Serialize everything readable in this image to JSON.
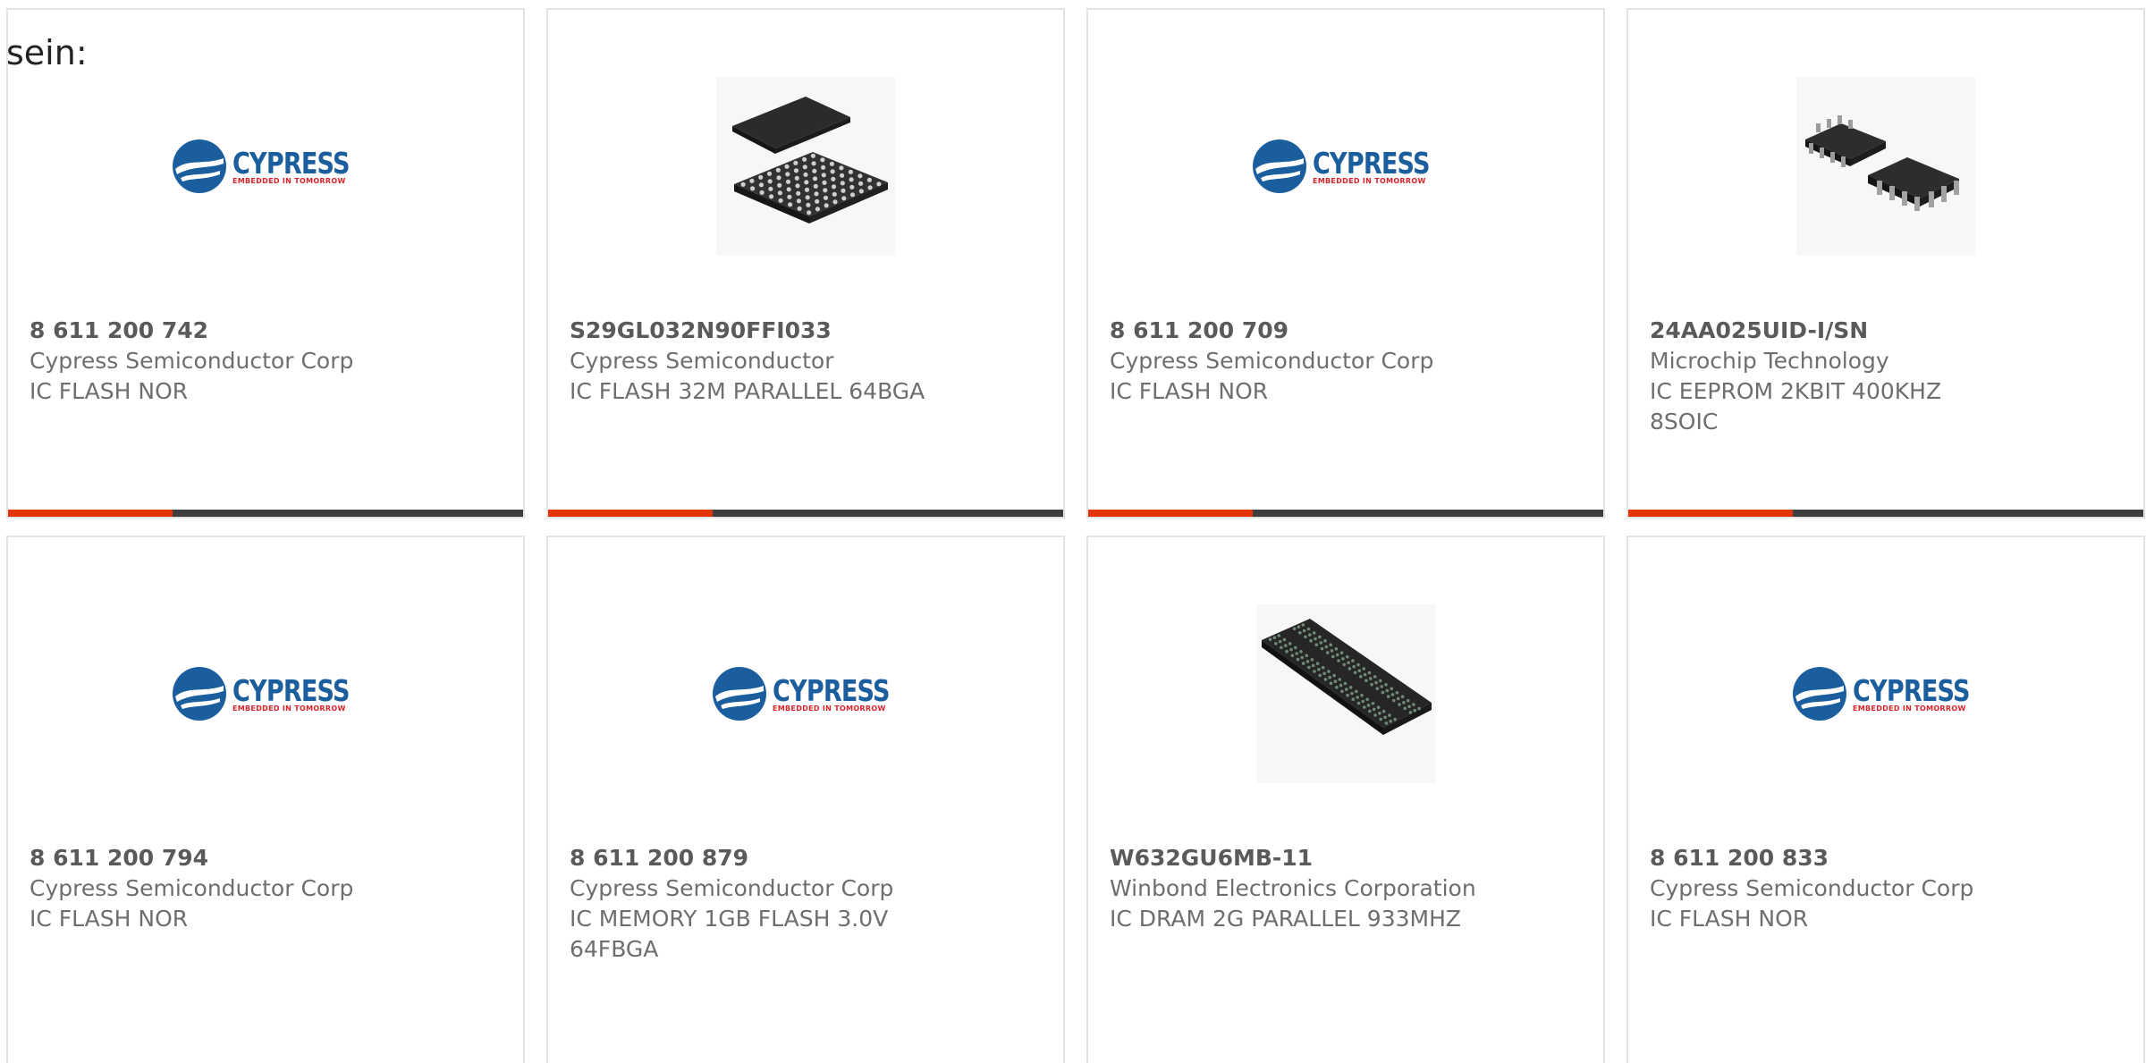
{
  "intro_text": "sein:",
  "colors": {
    "accent": "#e5340c",
    "bar_track": "#3b3d3f",
    "logo_blue": "#1b5e9e",
    "logo_red": "#d8232a"
  },
  "logo": {
    "word": "CYPRESS",
    "tagline": "EMBEDDED IN TOMORROW"
  },
  "products": [
    {
      "part": "8 611 200 742",
      "manufacturer": "Cypress Semiconductor Corp",
      "description": "IC FLASH NOR",
      "image": "cypress-logo",
      "progress_fraction": 0.32
    },
    {
      "part": "S29GL032N90FFI033",
      "manufacturer": "Cypress Semiconductor",
      "description": "IC FLASH 32M PARALLEL 64BGA",
      "image": "bga-chip-photo",
      "progress_fraction": 0.32
    },
    {
      "part": "8 611 200 709",
      "manufacturer": "Cypress Semiconductor Corp",
      "description": "IC FLASH NOR",
      "image": "cypress-logo",
      "progress_fraction": 0.32
    },
    {
      "part": "24AA025UID-I/SN",
      "manufacturer": "Microchip Technology",
      "description": "IC EEPROM 2KBIT 400KHZ 8SOIC",
      "image": "soic-chip-photo",
      "progress_fraction": 0.32
    },
    {
      "part": "8 611 200 794",
      "manufacturer": "Cypress Semiconductor Corp",
      "description": "IC FLASH NOR",
      "image": "cypress-logo"
    },
    {
      "part": "8 611 200 879",
      "manufacturer": "Cypress Semiconductor Corp",
      "description": "IC MEMORY 1GB FLASH 3.0V 64FBGA",
      "image": "cypress-logo"
    },
    {
      "part": "W632GU6MB-11",
      "manufacturer": "Winbond Electronics Corporation",
      "description": "IC DRAM 2G PARALLEL 933MHZ",
      "image": "dram-chip-photo"
    },
    {
      "part": "8 611 200 833",
      "manufacturer": "Cypress Semiconductor Corp",
      "description": "IC FLASH NOR",
      "image": "cypress-logo"
    }
  ]
}
